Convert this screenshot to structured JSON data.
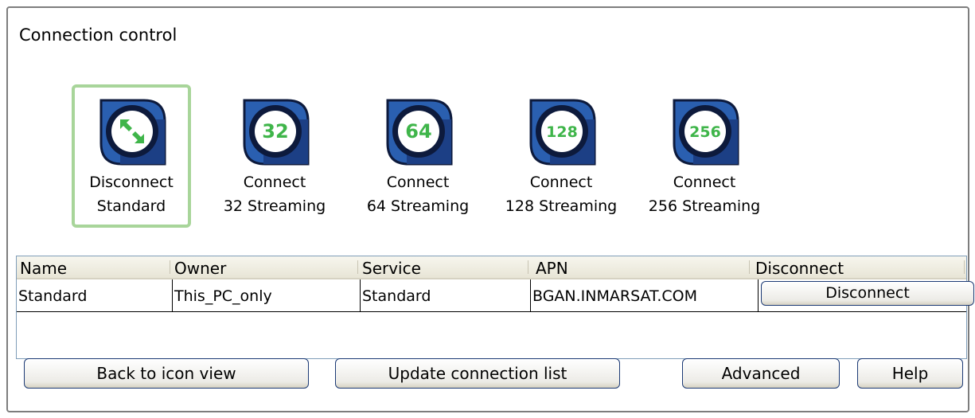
{
  "panel": {
    "title": "Connection control"
  },
  "tiles": [
    {
      "line1": "Disconnect",
      "line2": "Standard",
      "icon": "disconnect-arrows-icon",
      "badge": "",
      "selected": true
    },
    {
      "line1": "Connect",
      "line2": "32 Streaming",
      "icon": "streaming-32-icon",
      "badge": "32",
      "selected": false
    },
    {
      "line1": "Connect",
      "line2": "64 Streaming",
      "icon": "streaming-64-icon",
      "badge": "64",
      "selected": false
    },
    {
      "line1": "Connect",
      "line2": "128 Streaming",
      "icon": "streaming-128-icon",
      "badge": "128",
      "selected": false
    },
    {
      "line1": "Connect",
      "line2": "256 Streaming",
      "icon": "streaming-256-icon",
      "badge": "256",
      "selected": false
    }
  ],
  "table": {
    "columns": [
      "Name",
      "Owner",
      "Service",
      "APN",
      "Disconnect"
    ],
    "rows": [
      {
        "name": "Standard",
        "owner": "This_PC_only",
        "service": "Standard",
        "apn": "BGAN.INMARSAT.COM",
        "action": "Disconnect"
      }
    ]
  },
  "buttons": {
    "back": "Back to icon view",
    "update": "Update connection list",
    "advanced": "Advanced",
    "help": "Help"
  },
  "colors": {
    "icon_ring": "#0d1a3c",
    "icon_blue": "#2a5fb0",
    "badge_green": "#3fb54a",
    "selected_border": "#a8d59a"
  }
}
